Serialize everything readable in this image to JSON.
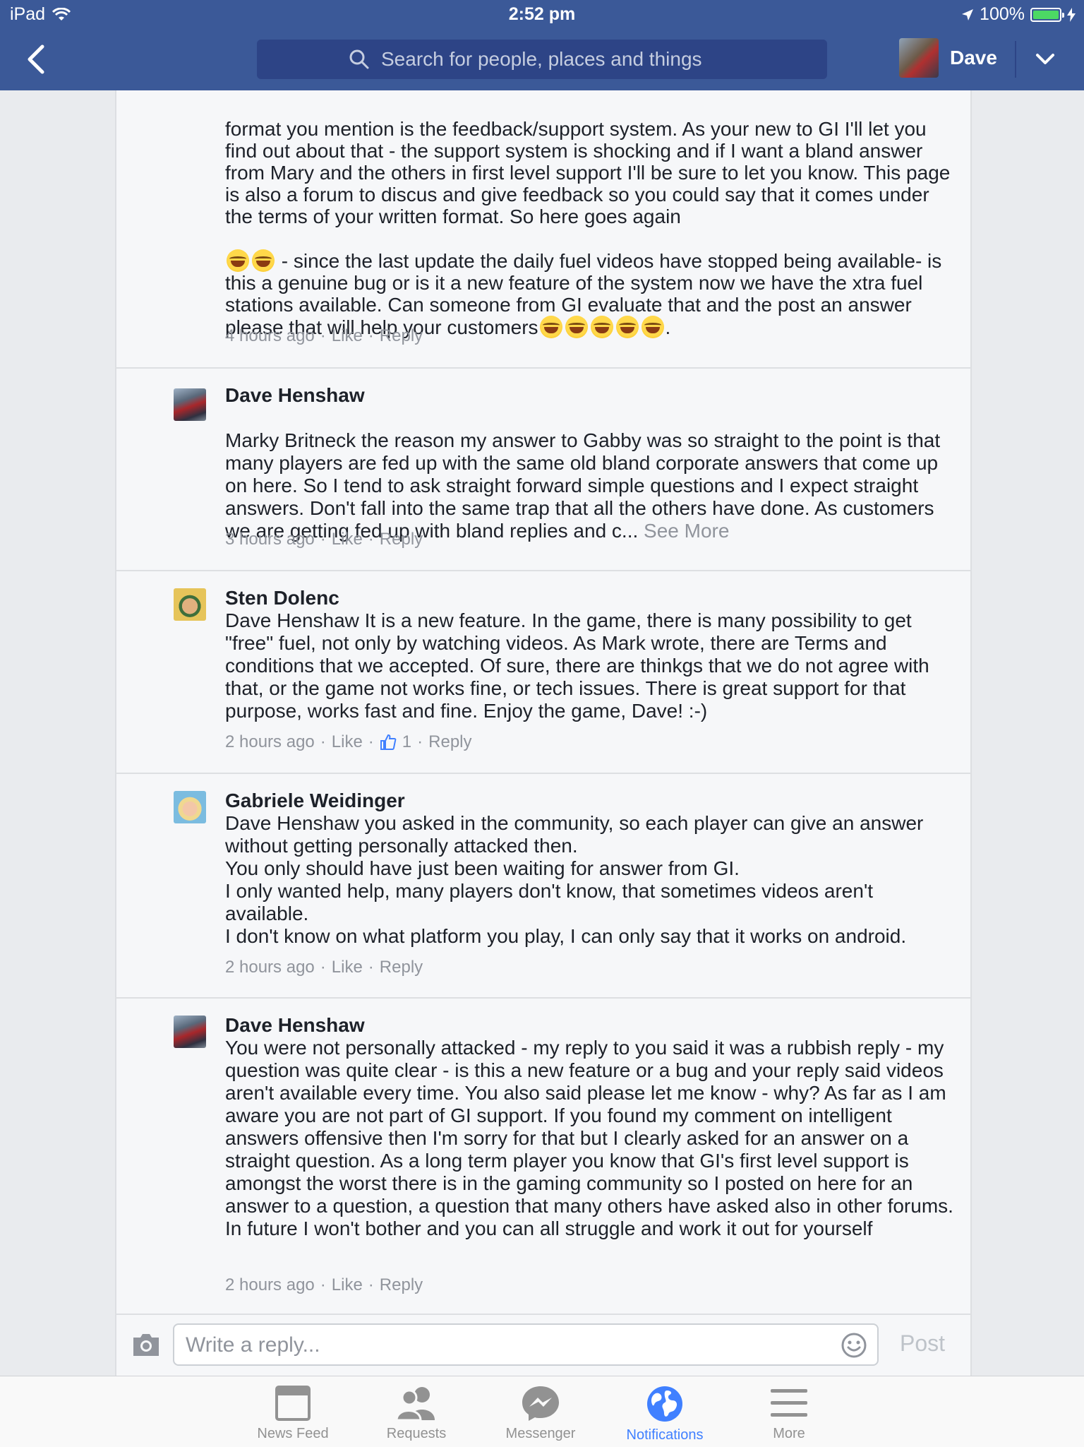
{
  "status_bar": {
    "device": "iPad",
    "time": "2:52 pm",
    "battery": "100%",
    "battery_level": 1.0
  },
  "nav": {
    "search_placeholder": "Search for people, places and things",
    "profile_name": "Dave"
  },
  "comments": [
    {
      "author": "",
      "text_top": "format you mention is the feedback/support system. As your new to GI I'll let you find out about that - the support system is shocking and if I want a bland answer from Mary and the others in first level support I'll be sure to let you know. This page is also a forum to discus and give feedback so you could say that it comes under the terms of your written format. So here goes again",
      "text_mid": " - since the last update the daily fuel videos have stopped being available- is this a genuine bug or is it a new feature of the system now we have the xtra fuel stations available.  Can someone from GI evaluate that and the post an answer please that will help your customers",
      "text_end": ".",
      "time": "4 hours ago",
      "like": "Like",
      "reply": "Reply"
    },
    {
      "author": "Dave Henshaw",
      "text": "Marky Britneck the reason my answer to Gabby was so straight to the point is that many players are fed up with the same old bland corporate answers that come up on here. So I tend to ask straight forward simple questions and I expect straight answers. Don't fall into the same trap that all the others have done. As customers we are getting fed up with bland replies and c...",
      "see_more": "See More",
      "time": "3 hours ago",
      "like": "Like",
      "reply": "Reply"
    },
    {
      "author": "Sten Dolenc",
      "text": "Dave Henshaw It is a new feature. In the game, there is many possibility to get \"free\" fuel, not only by watching videos. As Mark wrote, there are Terms and conditions that we accepted. Of sure, there are thinkgs that we do not agree with that, or the game not works fine, or tech issues. There is great support for that purpose, works fast and fine. Enjoy the game, Dave! :-)",
      "time": "2 hours ago",
      "like": "Like",
      "like_count": "1",
      "reply": "Reply"
    },
    {
      "author": "Gabriele Weidinger",
      "text": "Dave Henshaw you asked in the community, so each player can give an answer without getting personally attacked then.\nYou only should have just been waiting for answer from GI.\nI only wanted help, many players don't know, that sometimes videos aren't available.\nI don't know on what platform you play, I can only say that it works on android.",
      "time": "2 hours ago",
      "like": "Like",
      "reply": "Reply"
    },
    {
      "author": "Dave Henshaw",
      "text": "You were not personally attacked - my reply to you said it was a rubbish reply - my question was quite clear - is this a new feature or a bug and your reply said videos aren't available every time.  You also said please let me know - why? As far as I am aware you are not part of GI support. If you found my comment on intelligent answers offensive then I'm sorry for that but I clearly asked for an answer on a straight question.  As a long term player you know that GI's first level support is amongst the worst there is in the gaming community so I posted on here for an answer to a question, a question that many others have asked also in other forums. In future I won't bother and you can all struggle and work it out for yourself",
      "time": "2 hours ago",
      "like": "Like",
      "reply": "Reply"
    }
  ],
  "composer": {
    "placeholder": "Write a reply...",
    "post_label": "Post"
  },
  "tabs": [
    {
      "label": "News Feed",
      "icon": "news-feed-icon"
    },
    {
      "label": "Requests",
      "icon": "friend-requests-icon"
    },
    {
      "label": "Messenger",
      "icon": "messenger-icon"
    },
    {
      "label": "Notifications",
      "icon": "globe-icon",
      "active": true
    },
    {
      "label": "More",
      "icon": "menu-icon"
    }
  ],
  "colors": {
    "brand": "#3b5998",
    "active_tab": "#4080ff",
    "meta_gray": "#90949c"
  }
}
